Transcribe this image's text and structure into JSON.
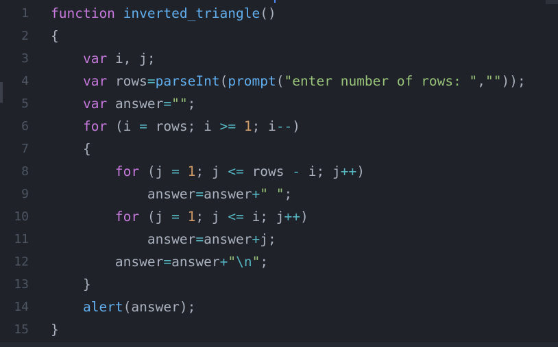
{
  "editor": {
    "line_numbers": [
      "1",
      "2",
      "3",
      "4",
      "5",
      "6",
      "7",
      "8",
      "9",
      "10",
      "11",
      "12",
      "13",
      "14",
      "15"
    ],
    "lines": [
      [
        {
          "t": "function",
          "c": "k"
        },
        {
          "t": " ",
          "c": "p"
        },
        {
          "t": "inverted_triangle",
          "c": "f"
        },
        {
          "t": "()",
          "c": "p"
        }
      ],
      [
        {
          "t": "{",
          "c": "p"
        }
      ],
      [
        {
          "t": "    ",
          "c": "p"
        },
        {
          "t": "var",
          "c": "k"
        },
        {
          "t": " i, j;",
          "c": "p"
        }
      ],
      [
        {
          "t": "    ",
          "c": "p"
        },
        {
          "t": "var",
          "c": "k"
        },
        {
          "t": " rows",
          "c": "p"
        },
        {
          "t": "=",
          "c": "o"
        },
        {
          "t": "parseInt",
          "c": "f"
        },
        {
          "t": "(",
          "c": "p"
        },
        {
          "t": "prompt",
          "c": "f"
        },
        {
          "t": "(",
          "c": "p"
        },
        {
          "t": "\"enter number of rows: \"",
          "c": "s"
        },
        {
          "t": ",",
          "c": "p"
        },
        {
          "t": "\"\"",
          "c": "s"
        },
        {
          "t": "));",
          "c": "p"
        }
      ],
      [
        {
          "t": "    ",
          "c": "p"
        },
        {
          "t": "var",
          "c": "k"
        },
        {
          "t": " answer",
          "c": "p"
        },
        {
          "t": "=",
          "c": "o"
        },
        {
          "t": "\"\"",
          "c": "s"
        },
        {
          "t": ";",
          "c": "p"
        }
      ],
      [
        {
          "t": "    ",
          "c": "p"
        },
        {
          "t": "for",
          "c": "k"
        },
        {
          "t": " (i ",
          "c": "p"
        },
        {
          "t": "=",
          "c": "o"
        },
        {
          "t": " rows; i ",
          "c": "p"
        },
        {
          "t": ">=",
          "c": "o"
        },
        {
          "t": " ",
          "c": "p"
        },
        {
          "t": "1",
          "c": "n"
        },
        {
          "t": "; i",
          "c": "p"
        },
        {
          "t": "--",
          "c": "o"
        },
        {
          "t": ")",
          "c": "p"
        }
      ],
      [
        {
          "t": "    {",
          "c": "p"
        }
      ],
      [
        {
          "t": "        ",
          "c": "p"
        },
        {
          "t": "for",
          "c": "k"
        },
        {
          "t": " (j ",
          "c": "p"
        },
        {
          "t": "=",
          "c": "o"
        },
        {
          "t": " ",
          "c": "p"
        },
        {
          "t": "1",
          "c": "n"
        },
        {
          "t": "; j ",
          "c": "p"
        },
        {
          "t": "<=",
          "c": "o"
        },
        {
          "t": " rows ",
          "c": "p"
        },
        {
          "t": "-",
          "c": "o"
        },
        {
          "t": " i; j",
          "c": "p"
        },
        {
          "t": "++",
          "c": "o"
        },
        {
          "t": ")",
          "c": "p"
        }
      ],
      [
        {
          "t": "            answer",
          "c": "p"
        },
        {
          "t": "=",
          "c": "o"
        },
        {
          "t": "answer",
          "c": "p"
        },
        {
          "t": "+",
          "c": "o"
        },
        {
          "t": "\" \"",
          "c": "s"
        },
        {
          "t": ";",
          "c": "p"
        }
      ],
      [
        {
          "t": "        ",
          "c": "p"
        },
        {
          "t": "for",
          "c": "k"
        },
        {
          "t": " (j ",
          "c": "p"
        },
        {
          "t": "=",
          "c": "o"
        },
        {
          "t": " ",
          "c": "p"
        },
        {
          "t": "1",
          "c": "n"
        },
        {
          "t": "; j ",
          "c": "p"
        },
        {
          "t": "<=",
          "c": "o"
        },
        {
          "t": " i; j",
          "c": "p"
        },
        {
          "t": "++",
          "c": "o"
        },
        {
          "t": ")",
          "c": "p"
        }
      ],
      [
        {
          "t": "            answer",
          "c": "p"
        },
        {
          "t": "=",
          "c": "o"
        },
        {
          "t": "answer",
          "c": "p"
        },
        {
          "t": "+",
          "c": "o"
        },
        {
          "t": "j;",
          "c": "p"
        }
      ],
      [
        {
          "t": "        answer",
          "c": "p"
        },
        {
          "t": "=",
          "c": "o"
        },
        {
          "t": "answer",
          "c": "p"
        },
        {
          "t": "+",
          "c": "o"
        },
        {
          "t": "\"",
          "c": "s"
        },
        {
          "t": "\\n",
          "c": "e"
        },
        {
          "t": "\"",
          "c": "s"
        },
        {
          "t": ";",
          "c": "p"
        }
      ],
      [
        {
          "t": "    }",
          "c": "p"
        }
      ],
      [
        {
          "t": "    ",
          "c": "p"
        },
        {
          "t": "alert",
          "c": "f"
        },
        {
          "t": "(answer);",
          "c": "p"
        }
      ],
      [
        {
          "t": "}",
          "c": "p"
        }
      ]
    ]
  },
  "colors": {
    "background": "#1f2228",
    "keyword": "#c678dd",
    "function": "#61afef",
    "string": "#98c379",
    "number": "#d19a66",
    "operator": "#56b6c2",
    "plain": "#abb2bf",
    "line_number": "#4e5563"
  }
}
